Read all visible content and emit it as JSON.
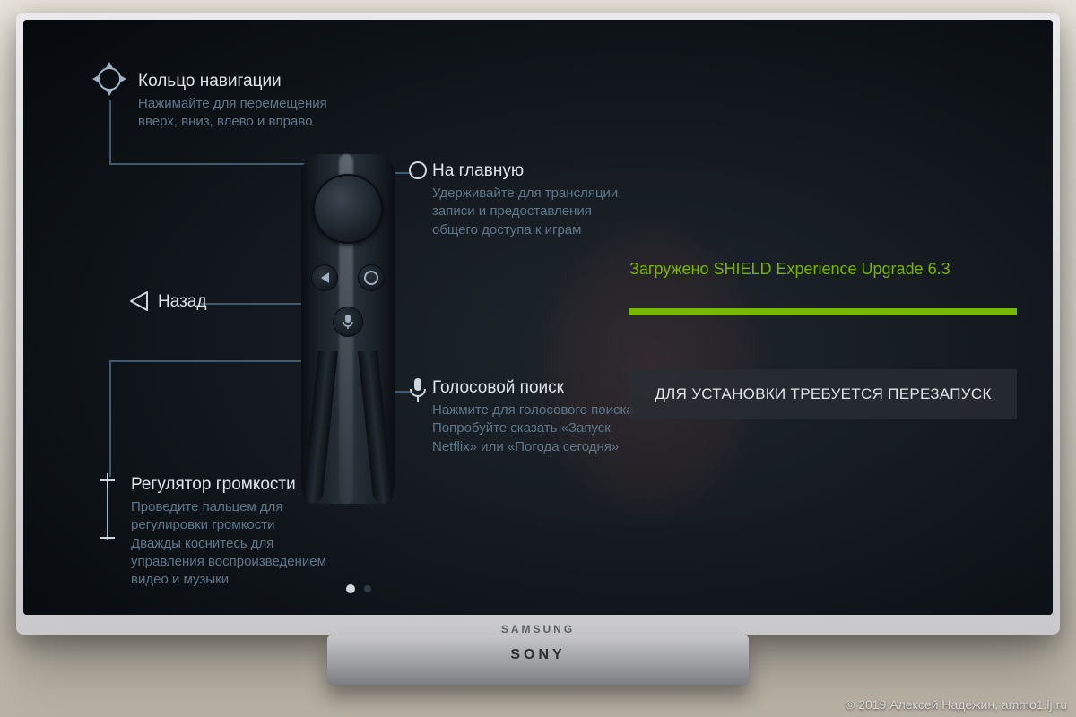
{
  "tv_brand": "SAMSUNG",
  "stand_brand": "SONY",
  "credit": "© 2019 Алексей Надёжин, ammo1.lj.ru",
  "remote": {
    "nav": {
      "title": "Кольцо навигации",
      "desc": "Нажимайте для перемещения вверх, вниз, влево и вправо"
    },
    "home": {
      "title": "На главную",
      "desc": "Удерживайте для трансляции, записи и предоставления общего доступа к играм"
    },
    "back": {
      "title": "Назад"
    },
    "voice": {
      "title": "Голосовой поиск",
      "desc": "Нажмите для голосового поиска\nПопробуйте сказать «Запуск Netflix» или «Погода сегодня»"
    },
    "volume": {
      "title": "Регулятор громкости",
      "desc": "Проведите пальцем для регулировки громкости\nДважды коснитесь для управления воспроизведением видео и музыки"
    }
  },
  "update": {
    "title": "Загружено SHIELD Experience Upgrade 6.3",
    "button": "ДЛЯ УСТАНОВКИ ТРЕБУЕТСЯ ПЕРЕЗАПУСК",
    "progress_pct": 100
  },
  "pager": {
    "current": 1,
    "total": 2
  },
  "colors": {
    "accent": "#76b900",
    "link": "#5f778b"
  }
}
